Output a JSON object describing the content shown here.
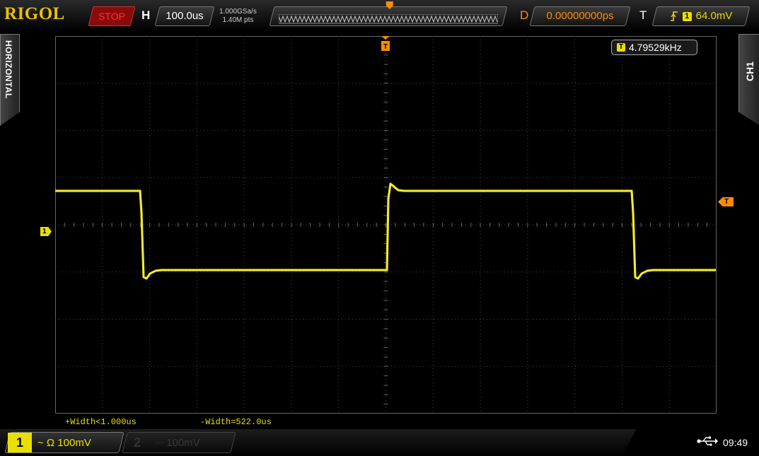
{
  "topbar": {
    "logo": "RIGOL",
    "run_state": "STOP",
    "h_label": "H",
    "timebase": "100.0us",
    "sample_rate": "1.000GSa/s",
    "mem_depth": "1.40M pts",
    "d_label": "D",
    "delay": "0.00000000ps",
    "t_label": "T",
    "trigger_channel": "1",
    "trigger_level": "64.0mV"
  },
  "side_tabs": {
    "left": "HORIZONTAL",
    "right": "CH1"
  },
  "readouts": {
    "freq_badge": "T",
    "frequency": "4.79529kHz",
    "meas_pos_width": "+Width<1.000us",
    "meas_neg_width": "-Width=522.0us"
  },
  "markers": {
    "ch1": "1",
    "trigger_level": "T",
    "trigger_pos": "T"
  },
  "bottombar": {
    "ch1_num": "1",
    "ch1_info": "~ Ω 100mV",
    "ch2_num": "2",
    "ch2_info": "⎓ 100mV",
    "clock": "09:49"
  },
  "colors": {
    "trace": "#e8e000",
    "grid": "#4a4a4a",
    "trigger": "#ff8c00",
    "stop": "#ff3030"
  }
}
